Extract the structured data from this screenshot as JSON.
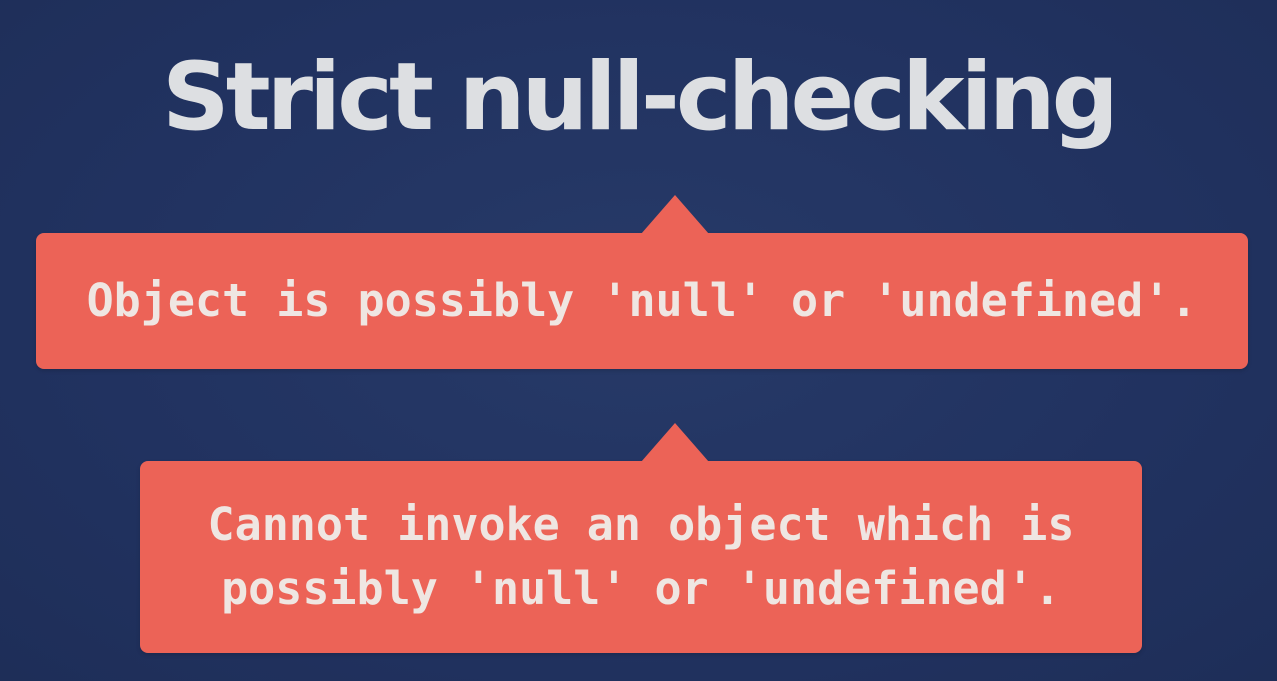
{
  "title": "Strict null-checking",
  "errors": [
    {
      "message": "Object is possibly 'null' or 'undefined'."
    },
    {
      "message": "Cannot invoke an object which is possibly 'null' or 'undefined'."
    }
  ],
  "colors": {
    "background": "#223460",
    "callout": "#ec6357",
    "title_text": "#dddfe2",
    "callout_text": "#efe6e2"
  }
}
